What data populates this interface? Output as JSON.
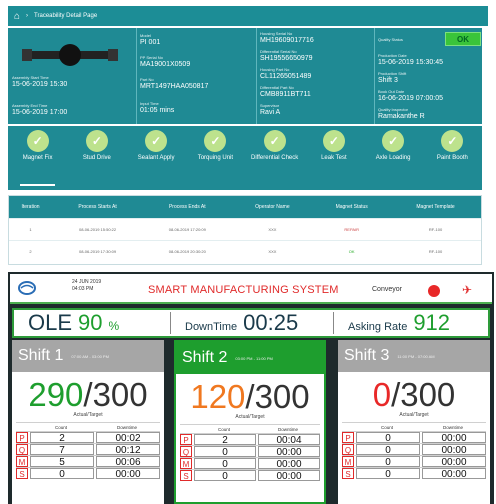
{
  "trace": {
    "breadcrumb": "Traceability Detail Page",
    "model": {
      "label": "Model",
      "value": "PI 001"
    },
    "serial": {
      "label": "PP Serial No",
      "value": "MA19001X0509"
    },
    "part": {
      "label": "Part No",
      "value": "MRT1497HAA050817"
    },
    "start": {
      "label": "Assembly Start Time",
      "value": "15-06-2019 15:30"
    },
    "end": {
      "label": "Assembly End Time",
      "value": "15-06-2019 17:00"
    },
    "hours": {
      "label": "Input Time",
      "value": "01:05 mins"
    },
    "housing_serial": {
      "label": "Housing Serial No",
      "value": "MH19609017716"
    },
    "diff_serial": {
      "label": "Differential Serial No",
      "value": "SH19556650979"
    },
    "housing_part": {
      "label": "Housing Part No",
      "value": "CL11265051489"
    },
    "diff_part": {
      "label": "Differential Part No",
      "value": "CMB8911BT711"
    },
    "supervisor": {
      "label": "Supervisor",
      "value": "Ravi A"
    },
    "quality": {
      "label": "Quality Status",
      "value": "OK"
    },
    "prod_date": {
      "label": "Production Date",
      "value": "15-06-2019 15:30:45"
    },
    "prod_shift": {
      "label": "Production Shift",
      "value": "Shift 3"
    },
    "book_date": {
      "label": "Book Out Date",
      "value": "16-06-2019 07:00:05"
    },
    "inspector": {
      "label": "Quality Inspector",
      "value": "Ramakanthe R"
    },
    "stations": [
      "Magnet Fix",
      "Stud Drive",
      "Sealant Apply",
      "Torquing Unit",
      "Differential Check",
      "Leak Test",
      "Axle Loading",
      "Paint Booth"
    ],
    "table": {
      "headers": [
        "Iteration",
        "Process Starts At",
        "Process Ends At",
        "Operator Name",
        "Magnet Status",
        "Magnet Template"
      ],
      "rows": [
        [
          "1",
          "08-06-2019 15:50:22",
          "08-06-2019 17:20:09",
          "XXX",
          "REPAIR",
          "RF-100"
        ],
        [
          "2",
          "08-06-2019 17:30:09",
          "08-06-2019 20:30:20",
          "XXX",
          "OK",
          "RF-100"
        ]
      ]
    }
  },
  "sms": {
    "date": "24 JUN 2019",
    "time": "04:03 PM",
    "title": "SMART MANUFACTURING SYSTEM",
    "conveyor": "Conveyor",
    "ole_label": "OLE",
    "ole_value": "90",
    "ole_unit": "%",
    "downtime_label": "DownTime",
    "downtime_value": "00:25",
    "asking_label": "Asking Rate",
    "asking_value": "912",
    "shifts": [
      {
        "name": "Shift 1",
        "time": "07:00 AM - 03:00 PM",
        "actual": "290",
        "target": "/300",
        "sub": "Actual/Target",
        "count": "Count",
        "downtime": "Downtime",
        "rows": [
          [
            "P",
            "2",
            "00:02"
          ],
          [
            "Q",
            "7",
            "00:12"
          ],
          [
            "M",
            "5",
            "00:06"
          ],
          [
            "S",
            "0",
            "00:00"
          ]
        ]
      },
      {
        "name": "Shift 2",
        "time": "03:00 PM - 11:00 PM",
        "actual": "120",
        "target": "/300",
        "sub": "Actual/Target",
        "count": "Count",
        "downtime": "Downtime",
        "rows": [
          [
            "P",
            "2",
            "00:04"
          ],
          [
            "Q",
            "0",
            "00:00"
          ],
          [
            "M",
            "0",
            "00:00"
          ],
          [
            "S",
            "0",
            "00:00"
          ]
        ]
      },
      {
        "name": "Shift 3",
        "time": "11:00 PM - 07:00 AM",
        "actual": "0",
        "target": "/300",
        "sub": "Actual/Target",
        "count": "Count",
        "downtime": "Downtime",
        "rows": [
          [
            "P",
            "0",
            "00:00"
          ],
          [
            "Q",
            "0",
            "00:00"
          ],
          [
            "M",
            "0",
            "00:00"
          ],
          [
            "S",
            "0",
            "00:00"
          ]
        ]
      }
    ],
    "colors": {
      "shift1": "#1e9e2e",
      "shift2": "#f07820",
      "shift3": "#e82828"
    }
  }
}
